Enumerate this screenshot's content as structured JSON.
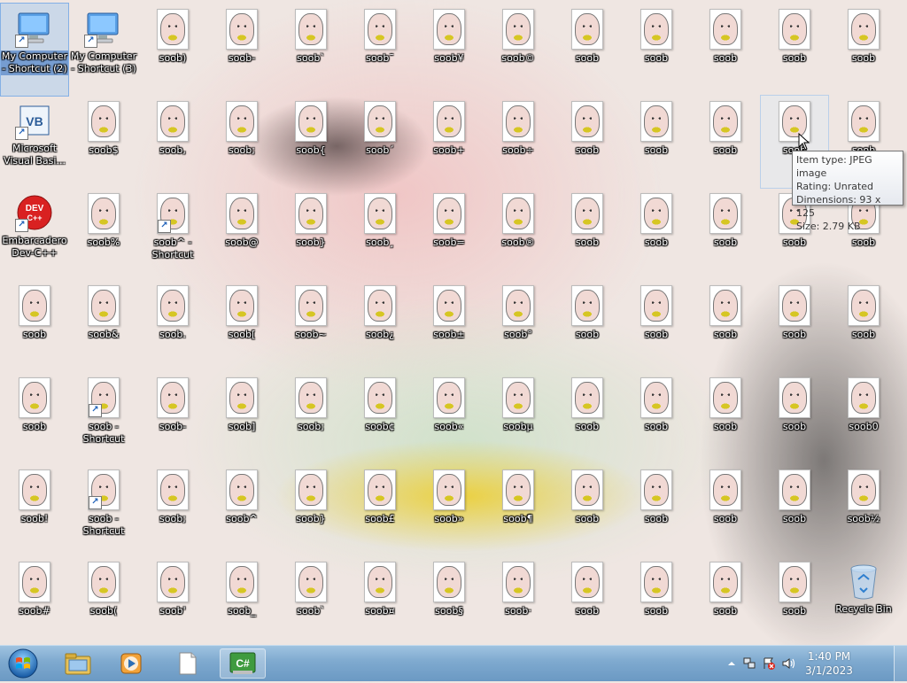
{
  "desktop": {
    "columns": [
      [
        "My Computer - Shortcut (2)",
        "Microsoft Visual Basi...",
        "Embarcadero Dev-C++",
        "soob",
        "soob",
        "soob!",
        "soob#"
      ],
      [
        "My Computer - Shortcut (3)",
        "soob$",
        "soob%",
        "soob&",
        "soob - Shortcut",
        "soob - Shortcut",
        "soob("
      ],
      [
        "soob)",
        "soob,",
        "soob^ - Shortcut",
        "soob.",
        "soob-",
        "soob;",
        "soob'"
      ],
      [
        "soob-",
        "soob;",
        "soob@",
        "soob[",
        "soob]",
        "soob^",
        "soob_"
      ],
      [
        "soob`",
        "soob{",
        "soob}",
        "soob~",
        "soob;",
        "soob}",
        "soob`"
      ],
      [
        "soob¯",
        "soob´",
        "soob¸",
        "soob¿",
        "soob¢",
        "soob£",
        "soob¤"
      ],
      [
        "soob¥",
        "soob+",
        "soob=",
        "soob±",
        "soob«",
        "soob»",
        "soob§"
      ],
      [
        "soob©",
        "soob÷",
        "soob®",
        "soob°",
        "soobµ",
        "soob¶",
        "soob·"
      ],
      [
        "soob",
        "soob",
        "soob",
        "soob",
        "soob",
        "soob",
        "soob"
      ],
      [
        "soob",
        "soob",
        "soob",
        "soob",
        "soob",
        "soob",
        "soob"
      ],
      [
        "soob",
        "soob",
        "soob",
        "soob",
        "soob",
        "soob",
        "soob"
      ],
      [
        "soob",
        "soob",
        "soob",
        "soob",
        "soob",
        "soob",
        "soob"
      ],
      [
        "soob",
        "soob",
        "soob",
        "soob",
        "soob0",
        "soob½",
        "Recycle Bin"
      ]
    ],
    "icon_types": [
      [
        "computer",
        "vb",
        "devcpp",
        "image",
        "image",
        "image",
        "image"
      ],
      [
        "computer",
        "image",
        "image",
        "image",
        "image-shortcut",
        "image-shortcut",
        "image"
      ],
      [
        "image",
        "image",
        "image-shortcut",
        "image",
        "image",
        "image",
        "image"
      ],
      [
        "image",
        "image",
        "image",
        "image",
        "image",
        "image",
        "image"
      ],
      [
        "image",
        "image",
        "image",
        "image",
        "image",
        "image",
        "image"
      ],
      [
        "image",
        "image",
        "image",
        "image",
        "image",
        "image",
        "image"
      ],
      [
        "image",
        "image",
        "image",
        "image",
        "image",
        "image",
        "image"
      ],
      [
        "image",
        "image",
        "image",
        "image",
        "image",
        "image",
        "image"
      ],
      [
        "image",
        "image",
        "image",
        "image",
        "image",
        "image",
        "image"
      ],
      [
        "image",
        "image",
        "image",
        "image",
        "image",
        "image",
        "image"
      ],
      [
        "image",
        "image",
        "image",
        "image",
        "image",
        "image",
        "image"
      ],
      [
        "image",
        "image",
        "image",
        "image",
        "image",
        "image",
        "image"
      ],
      [
        "image",
        "image",
        "image",
        "image",
        "image",
        "image",
        "recycle-bin"
      ]
    ]
  },
  "tooltip": {
    "type": "Item type: JPEG image",
    "rating": "Rating: Unrated",
    "dimensions": "Dimensions: 93 x 125",
    "size": "Size: 2.79 KB"
  },
  "taskbar": {
    "items": [
      "windows-explorer-icon",
      "media-player-icon",
      "notepad-icon",
      "csharp-icon"
    ],
    "csharp_label": "C#",
    "tray": [
      "show-hidden-icons",
      "network-icon",
      "action-center-icon",
      "volume-icon"
    ],
    "time": "1:40 PM",
    "date": "3/1/2023"
  },
  "devcpp_text": "DEV C++",
  "vb_text": "VB"
}
